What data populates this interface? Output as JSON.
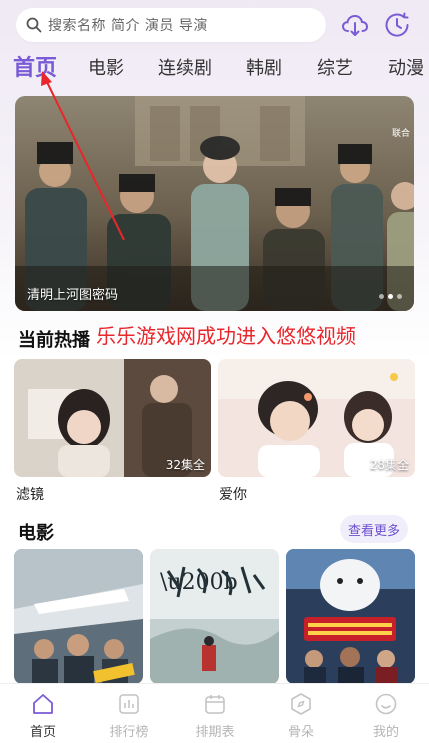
{
  "search": {
    "placeholder": "搜索名称 简介 演员 导演"
  },
  "top_icons": {
    "download": "cloud-download-icon",
    "history": "clock-history-icon"
  },
  "tabs": [
    {
      "label": "首页",
      "active": true
    },
    {
      "label": "电影",
      "active": false
    },
    {
      "label": "连续剧",
      "active": false
    },
    {
      "label": "韩剧",
      "active": false
    },
    {
      "label": "综艺",
      "active": false
    },
    {
      "label": "动漫",
      "active": false
    }
  ],
  "banner": {
    "caption": "清明上河图密码",
    "corner_text": "联合",
    "page_count": 3,
    "current_page": 2
  },
  "hot_section": {
    "title": "当前热播",
    "items": [
      {
        "title": "滤镜",
        "episodes": "32集全"
      },
      {
        "title": "爱你",
        "episodes": "28集全"
      }
    ]
  },
  "annotation": "乐乐游戏网成功进入悠悠视频",
  "movie_section": {
    "title": "电影",
    "more_label": "查看更多"
  },
  "bottom_nav": [
    {
      "label": "首页",
      "icon": "home-icon",
      "active": true
    },
    {
      "label": "排行榜",
      "icon": "ranking-icon",
      "active": false
    },
    {
      "label": "排期表",
      "icon": "calendar-icon",
      "active": false
    },
    {
      "label": "骨朵",
      "icon": "compass-icon",
      "active": false
    },
    {
      "label": "我的",
      "icon": "smiley-profile-icon",
      "active": false
    }
  ],
  "colors": {
    "accent": "#7a5bd6",
    "annotation": "#e8262b",
    "nav_inactive": "#b5b5b5"
  }
}
